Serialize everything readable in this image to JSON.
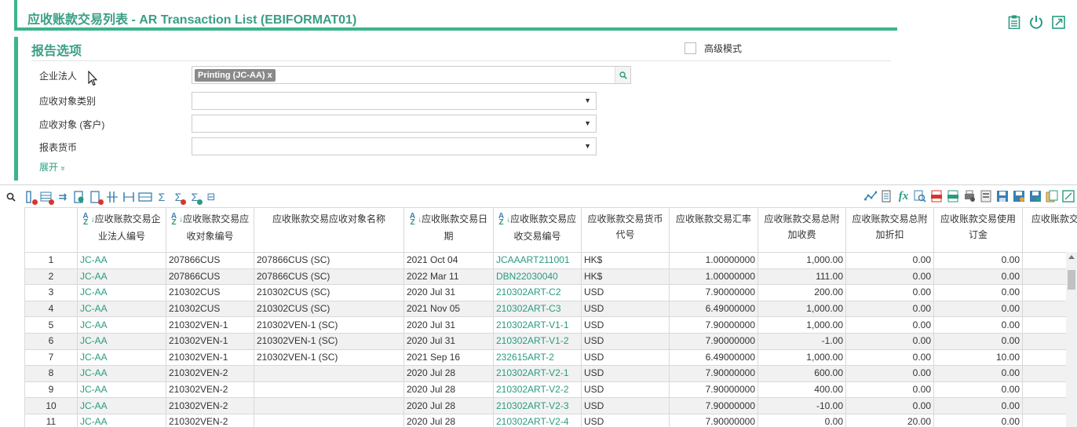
{
  "page": {
    "title": "应收账款交易列表 - AR Transaction List (EBIFORMAT01)"
  },
  "top_icons": [
    "clipboard-icon",
    "power-icon",
    "expand-icon"
  ],
  "options": {
    "header": "报告选项",
    "advanced_label": "高级模式",
    "entity_label": "企业法人",
    "entity_tag": "Printing (JC-AA)",
    "entity_tag_remove": "x",
    "ar_type_label": "应收对象类别",
    "ar_object_label": "应收对象 (客户)",
    "currency_label": "报表货币",
    "expand_label": "展开",
    "expand_chevron": "»"
  },
  "toolbar": {
    "search_glyph": "🔍"
  },
  "table": {
    "headers": [
      "",
      "应收账款交易企业法人编号",
      "应收账款交易应收对象编号",
      "应收账款交易应收对象名称",
      "应收账款交易日期",
      "应收账款交易应收交易编号",
      "应收账款交易货币代号",
      "应收账款交易汇率",
      "应收账款交易总附加收费",
      "应收账款交易总附加折扣",
      "应收账款交易使用订金",
      "应收账款交易总额"
    ],
    "rows": [
      [
        "1",
        "JC-AA",
        "207866CUS",
        "207866CUS (SC)",
        "2021 Oct 04",
        "JCAAART211001",
        "HK$",
        "1.00000000",
        "1,000.00",
        "0.00",
        "0.00",
        ""
      ],
      [
        "2",
        "JC-AA",
        "207866CUS",
        "207866CUS (SC)",
        "2022 Mar 11",
        "DBN22030040",
        "HK$",
        "1.00000000",
        "111.00",
        "0.00",
        "0.00",
        ""
      ],
      [
        "3",
        "JC-AA",
        "210302CUS",
        "210302CUS (SC)",
        "2020 Jul 31",
        "210302ART-C2",
        "USD",
        "7.90000000",
        "200.00",
        "0.00",
        "0.00",
        ""
      ],
      [
        "4",
        "JC-AA",
        "210302CUS",
        "210302CUS (SC)",
        "2021 Nov 05",
        "210302ART-C3",
        "USD",
        "6.49000000",
        "1,000.00",
        "0.00",
        "0.00",
        ""
      ],
      [
        "5",
        "JC-AA",
        "210302VEN-1",
        "210302VEN-1 (SC)",
        "2020 Jul 31",
        "210302ART-V1-1",
        "USD",
        "7.90000000",
        "1,000.00",
        "0.00",
        "0.00",
        ""
      ],
      [
        "6",
        "JC-AA",
        "210302VEN-1",
        "210302VEN-1 (SC)",
        "2020 Jul 31",
        "210302ART-V1-2",
        "USD",
        "7.90000000",
        "-1.00",
        "0.00",
        "0.00",
        ""
      ],
      [
        "7",
        "JC-AA",
        "210302VEN-1",
        "210302VEN-1 (SC)",
        "2021 Sep 16",
        "232615ART-2",
        "USD",
        "6.49000000",
        "1,000.00",
        "0.00",
        "10.00",
        ""
      ],
      [
        "8",
        "JC-AA",
        "210302VEN-2",
        "",
        "2020 Jul 28",
        "210302ART-V2-1",
        "USD",
        "7.90000000",
        "600.00",
        "0.00",
        "0.00",
        ""
      ],
      [
        "9",
        "JC-AA",
        "210302VEN-2",
        "",
        "2020 Jul 28",
        "210302ART-V2-2",
        "USD",
        "7.90000000",
        "400.00",
        "0.00",
        "0.00",
        ""
      ],
      [
        "10",
        "JC-AA",
        "210302VEN-2",
        "",
        "2020 Jul 28",
        "210302ART-V2-3",
        "USD",
        "7.90000000",
        "-10.00",
        "0.00",
        "0.00",
        ""
      ],
      [
        "11",
        "JC-AA",
        "210302VEN-2",
        "",
        "2020 Jul 28",
        "210302ART-V2-4",
        "USD",
        "7.90000000",
        "0.00",
        "20.00",
        "0.00",
        ""
      ]
    ]
  }
}
